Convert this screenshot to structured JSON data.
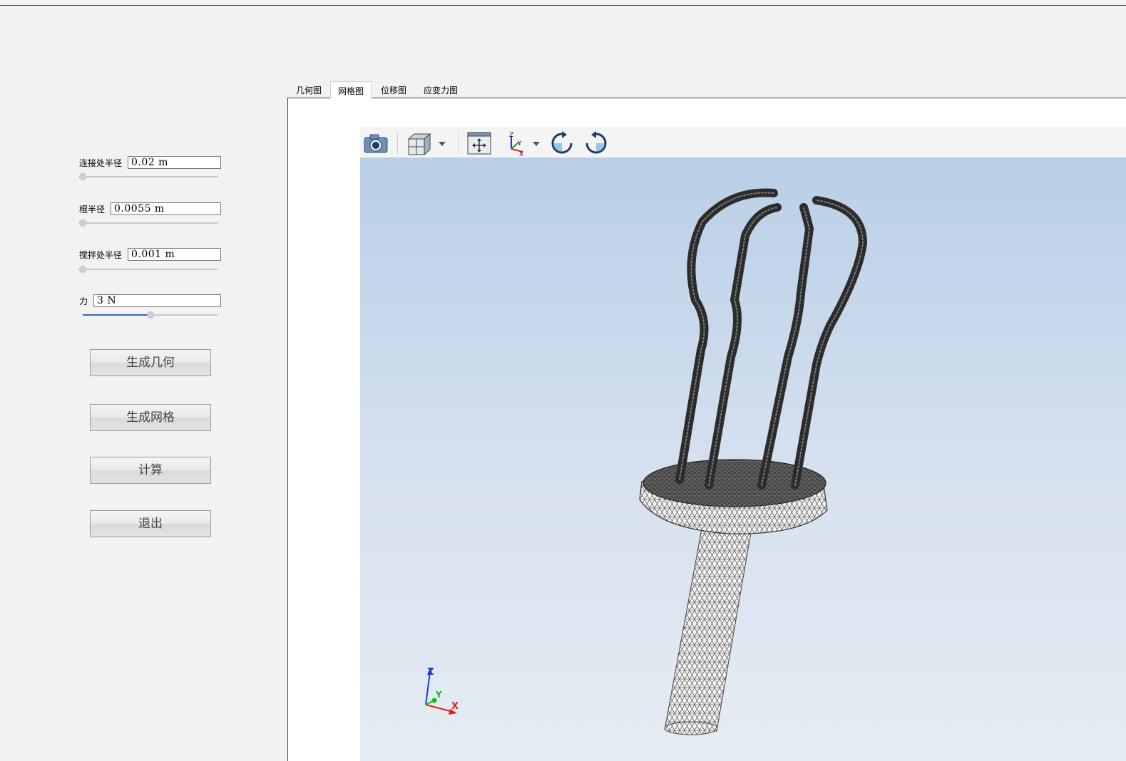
{
  "params": [
    {
      "label": "连接处半径",
      "value": "0.02 m",
      "slider_level": 0.0
    },
    {
      "label": "棍半径",
      "value": "0.0055 m",
      "slider_level": 0.0
    },
    {
      "label": "搅拌处半径",
      "value": "0.001 m",
      "slider_level": 0.0
    },
    {
      "label": "力",
      "value": "3 N",
      "slider_level": 0.5
    }
  ],
  "buttons": {
    "generate_geometry": "生成几何",
    "generate_mesh": "生成网格",
    "compute": "计算",
    "exit": "退出"
  },
  "tabs": [
    {
      "label": "几何图",
      "active": false
    },
    {
      "label": "网格图",
      "active": true
    },
    {
      "label": "位移图",
      "active": false
    },
    {
      "label": "应变力图",
      "active": false
    }
  ],
  "toolbar": {
    "icons": [
      "camera-icon",
      "cube-view-icon",
      "dropdown-arrow-icon",
      "fit-view-icon",
      "axes-icon",
      "dropdown-arrow-icon",
      "rotate-cw-icon",
      "rotate-ccw-icon"
    ]
  },
  "axes_triad": {
    "z": "Z",
    "y": "Y",
    "x": "X"
  },
  "axes_icon_labels": {
    "z": "Z",
    "y": "Y",
    "x": "X"
  },
  "colors": {
    "accent": "#2b6cb0",
    "viewport_top": "#b9cfe7",
    "viewport_bottom": "#e6ecf3",
    "axis_x": "#e02020",
    "axis_y": "#10c010",
    "axis_z": "#1a3fd0"
  }
}
